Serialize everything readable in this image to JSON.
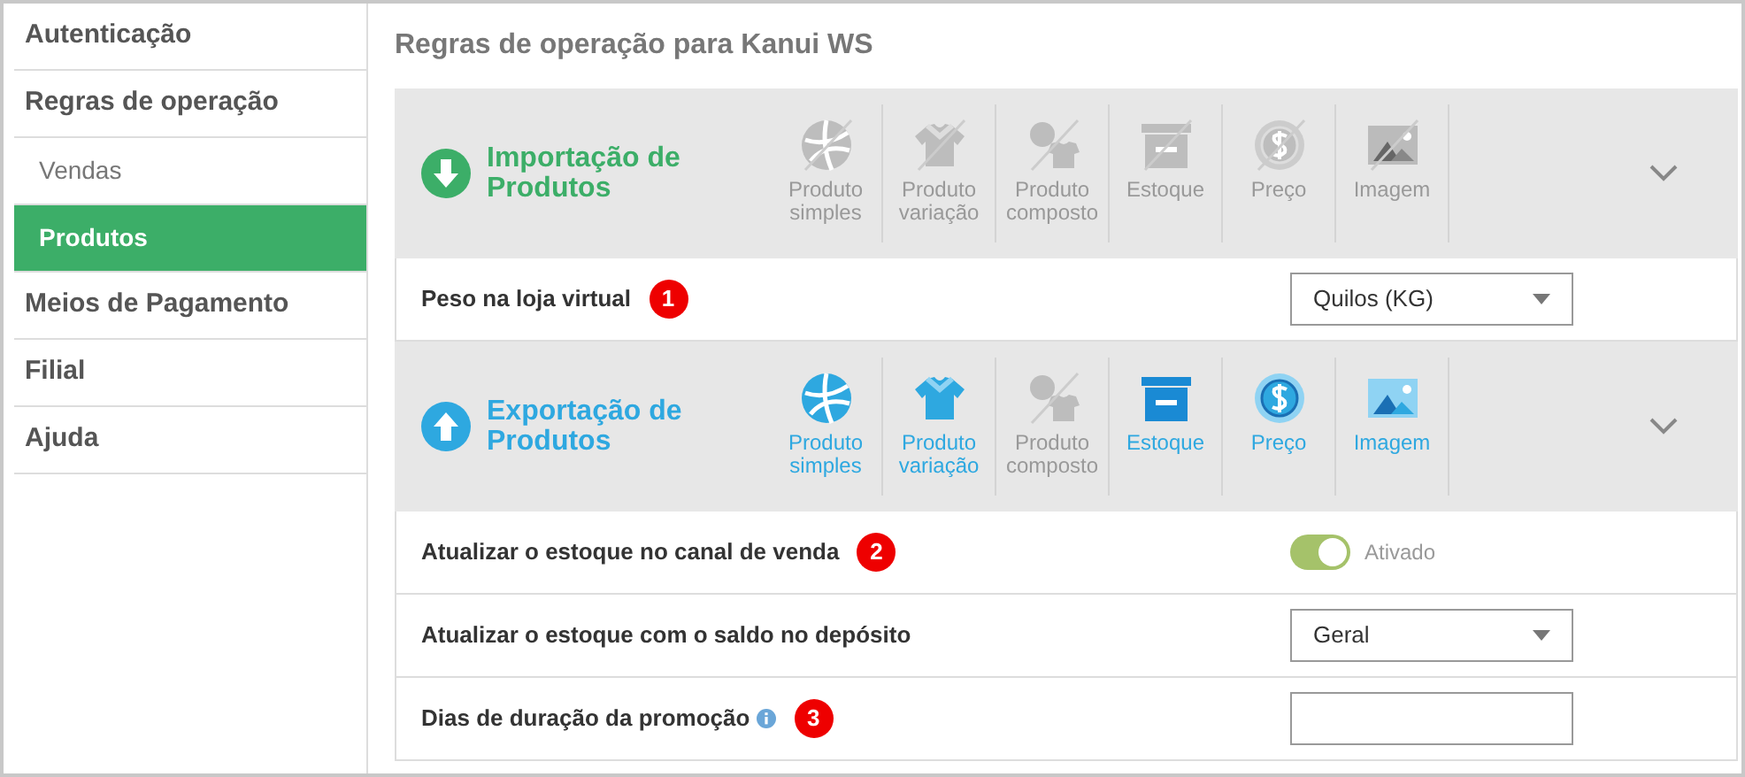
{
  "sidebar": {
    "items": [
      {
        "label": "Autenticação",
        "kind": "main",
        "selected": false
      },
      {
        "label": "Regras de operação",
        "kind": "main",
        "selected": false
      },
      {
        "label": "Vendas",
        "kind": "sub",
        "selected": false
      },
      {
        "label": "Produtos",
        "kind": "sub",
        "selected": true
      },
      {
        "label": "Meios de Pagamento",
        "kind": "main",
        "selected": false
      },
      {
        "label": "Filial",
        "kind": "main",
        "selected": false
      },
      {
        "label": "Ajuda",
        "kind": "main",
        "selected": false
      }
    ]
  },
  "page_title": "Regras de operação para Kanui WS",
  "sections": [
    {
      "kind": "import",
      "title": "Importação de Produtos",
      "options": [
        {
          "kind": "ball",
          "label": "Produto simples",
          "enabled": false
        },
        {
          "kind": "shirt",
          "label": "Produto variação",
          "enabled": false
        },
        {
          "kind": "composite",
          "label": "Produto composto",
          "enabled": false
        },
        {
          "kind": "box",
          "label": "Estoque",
          "enabled": false
        },
        {
          "kind": "coin",
          "label": "Preço",
          "enabled": false
        },
        {
          "kind": "image",
          "label": "Imagem",
          "enabled": false
        }
      ],
      "rows": [
        {
          "kind": "select",
          "label": "Peso na loja virtual",
          "badge": "1",
          "value": "Quilos (KG)"
        }
      ]
    },
    {
      "kind": "export",
      "title": "Exportação de Produtos",
      "options": [
        {
          "kind": "ball",
          "label": "Produto simples",
          "enabled": true
        },
        {
          "kind": "shirt",
          "label": "Produto variação",
          "enabled": true
        },
        {
          "kind": "composite",
          "label": "Produto composto",
          "enabled": false
        },
        {
          "kind": "box",
          "label": "Estoque",
          "enabled": true
        },
        {
          "kind": "coin",
          "label": "Preço",
          "enabled": true
        },
        {
          "kind": "image",
          "label": "Imagem",
          "enabled": true
        }
      ],
      "rows": [
        {
          "kind": "toggle",
          "label": "Atualizar o estoque no canal de venda",
          "badge": "2",
          "on": true,
          "state_label": "Ativado"
        },
        {
          "kind": "select",
          "label": "Atualizar o estoque com o saldo no depósito",
          "value": "Geral"
        },
        {
          "kind": "input",
          "label": "Dias de duração da promoção",
          "info": true,
          "badge": "3"
        }
      ]
    }
  ]
}
